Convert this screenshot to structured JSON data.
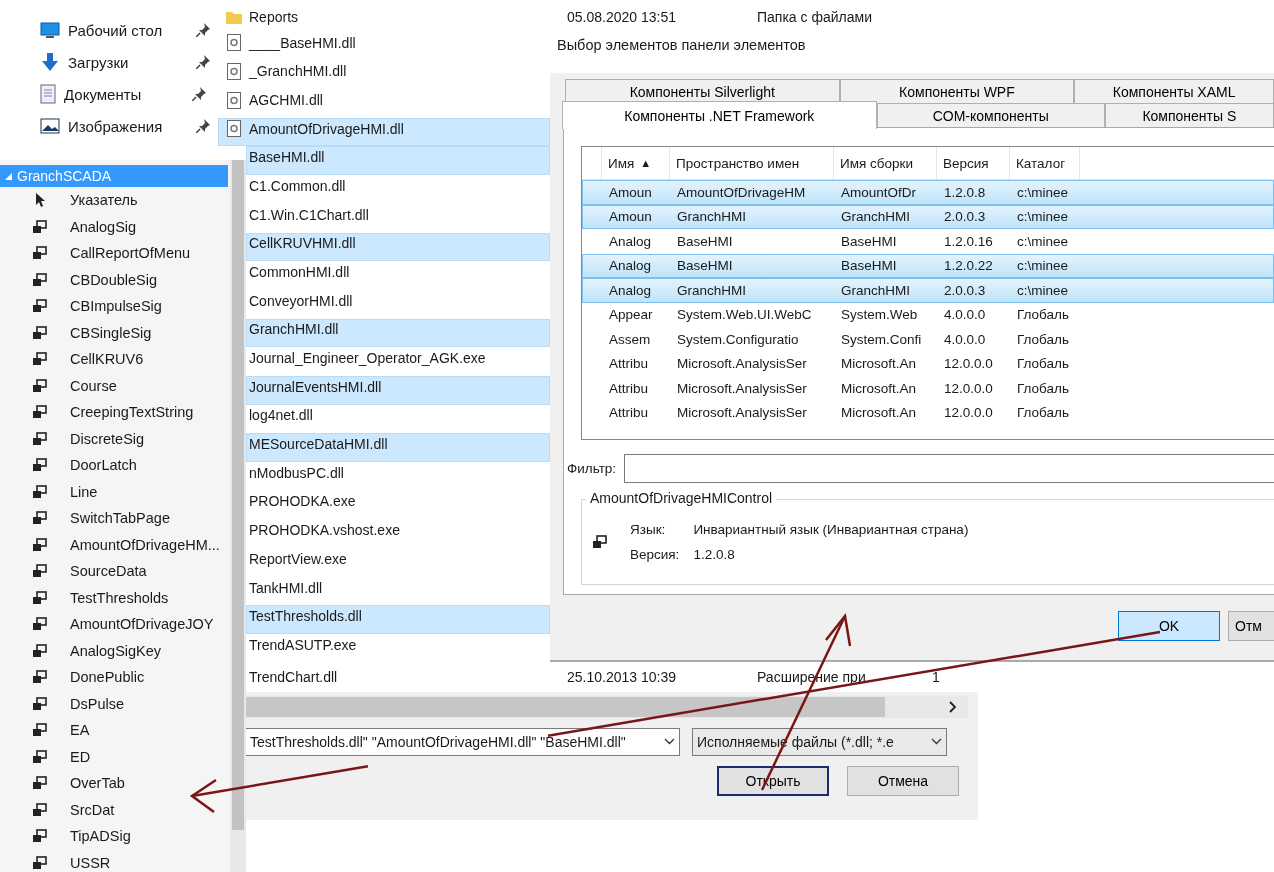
{
  "quick_access": [
    {
      "label": "Рабочий стол",
      "kind": "desktop"
    },
    {
      "label": "Загрузки",
      "kind": "downloads"
    },
    {
      "label": "Документы",
      "kind": "documents"
    },
    {
      "label": "Изображения",
      "kind": "pictures"
    }
  ],
  "toolbox": {
    "group": "GranchSCADA",
    "group_expanded": true,
    "items": [
      {
        "label": "Указатель",
        "kind": "pointer"
      },
      {
        "label": "AnalogSig",
        "kind": "control"
      },
      {
        "label": "CallReportOfMenu",
        "kind": "control"
      },
      {
        "label": "CBDoubleSig",
        "kind": "control"
      },
      {
        "label": "CBImpulseSig",
        "kind": "control"
      },
      {
        "label": "CBSingleSig",
        "kind": "control"
      },
      {
        "label": "CellKRUV6",
        "kind": "control"
      },
      {
        "label": "Course",
        "kind": "control"
      },
      {
        "label": "CreepingTextString",
        "kind": "control"
      },
      {
        "label": "DiscreteSig",
        "kind": "control"
      },
      {
        "label": "DoorLatch",
        "kind": "control"
      },
      {
        "label": "Line",
        "kind": "control"
      },
      {
        "label": "SwitchTabPage",
        "kind": "control"
      },
      {
        "label": "AmountOfDrivageHM...",
        "kind": "control"
      },
      {
        "label": "SourceData",
        "kind": "control"
      },
      {
        "label": "TestThresholds",
        "kind": "control"
      },
      {
        "label": "AmountOfDrivageJOY",
        "kind": "control"
      },
      {
        "label": "AnalogSigKey",
        "kind": "control"
      },
      {
        "label": "DonePublic",
        "kind": "control"
      },
      {
        "label": "DsPulse",
        "kind": "control"
      },
      {
        "label": "EA",
        "kind": "control"
      },
      {
        "label": "ED",
        "kind": "control"
      },
      {
        "label": "OverTab",
        "kind": "control"
      },
      {
        "label": "SrcDat",
        "kind": "control"
      },
      {
        "label": "TipADSig",
        "kind": "control"
      },
      {
        "label": "USSR",
        "kind": "control"
      }
    ]
  },
  "file_dialog": {
    "files": [
      {
        "name": "Reports",
        "kind": "folder",
        "selected": false,
        "date": "05.08.2020 13:51",
        "type": "Папка с файлами"
      },
      {
        "name": "____BaseHMI.dll",
        "kind": "dll",
        "selected": false
      },
      {
        "name": "_GranchHMI.dll",
        "kind": "dll",
        "selected": false
      },
      {
        "name": "AGCHMI.dll",
        "kind": "dll",
        "selected": false
      },
      {
        "name": "AmountOfDrivageHMI.dll",
        "kind": "dll",
        "selected": true
      },
      {
        "name": "BaseHMI.dll",
        "selected": true
      },
      {
        "name": "C1.Common.dll",
        "selected": false
      },
      {
        "name": "C1.Win.C1Chart.dll",
        "selected": false
      },
      {
        "name": "CellKRUVHMI.dll",
        "selected": true
      },
      {
        "name": "CommonHMI.dll",
        "selected": false
      },
      {
        "name": "ConveyorHMI.dll",
        "selected": false
      },
      {
        "name": "GranchHMI.dll",
        "selected": true
      },
      {
        "name": "Journal_Engineer_Operator_AGK.exe",
        "selected": false
      },
      {
        "name": "JournalEventsHMI.dll",
        "selected": true
      },
      {
        "name": "log4net.dll",
        "selected": false
      },
      {
        "name": "MESourceDataHMI.dll",
        "selected": true
      },
      {
        "name": "nModbusPC.dll",
        "selected": false
      },
      {
        "name": "PROHODKA.exe",
        "selected": false
      },
      {
        "name": "PROHODKA.vshost.exe",
        "selected": false
      },
      {
        "name": "ReportView.exe",
        "selected": false
      },
      {
        "name": "TankHMI.dll",
        "selected": false
      },
      {
        "name": "TestThresholds.dll",
        "selected": true
      },
      {
        "name": "TrendASUTP.exe",
        "selected": false
      },
      {
        "name": "TrendChart.dll",
        "selected": false,
        "date": "25.10.2013 10:39",
        "type": "Расширение при",
        "size": "1"
      }
    ],
    "file_name": "TestThresholds.dll\" \"AmountOfDrivageHMI.dll\" \"BaseHMI.dll\"",
    "file_type": "Исполняемые файлы (*.dll; *.e",
    "buttons": [
      {
        "label": "Открыть",
        "default": true
      },
      {
        "label": "Отмена",
        "default": false
      }
    ]
  },
  "choose_items_dialog": {
    "title": "Выбор элементов панели элементов",
    "tab_rows": [
      [
        {
          "label": "Компоненты Silverlight",
          "selected": false
        },
        {
          "label": "Компоненты WPF",
          "selected": false
        },
        {
          "label": "Компоненты XAML",
          "selected": false
        }
      ],
      [
        {
          "label": "Компоненты .NET Framework",
          "selected": true
        },
        {
          "label": "COM-компоненты",
          "selected": false
        },
        {
          "label": "Компоненты S",
          "selected": false
        }
      ]
    ],
    "table": {
      "columns": [
        {
          "label": "Имя",
          "sort_mark": "▲"
        },
        {
          "label": "Пространство имен"
        },
        {
          "label": "Имя сборки"
        },
        {
          "label": "Версия"
        },
        {
          "label": "Каталог"
        }
      ],
      "rows": [
        {
          "selected": true,
          "cells": [
            "Amoun",
            "AmountOfDrivageHM",
            "AmountOfDr",
            "1.2.0.8",
            "c:\\minee"
          ]
        },
        {
          "selected": true,
          "cells": [
            "Amoun",
            "GranchHMI",
            "GranchHMI",
            "2.0.0.3",
            "c:\\minee"
          ]
        },
        {
          "selected": false,
          "cells": [
            "Analog",
            "BaseHMI",
            "BaseHMI",
            "1.2.0.16",
            "c:\\minee"
          ]
        },
        {
          "selected": true,
          "cells": [
            "Analog",
            "BaseHMI",
            "BaseHMI",
            "1.2.0.22",
            "c:\\minee"
          ]
        },
        {
          "selected": true,
          "cells": [
            "Analog",
            "GranchHMI",
            "GranchHMI",
            "2.0.0.3",
            "c:\\minee"
          ]
        },
        {
          "selected": false,
          "cells": [
            "Appear",
            "System.Web.UI.WebC",
            "System.Web",
            "4.0.0.0",
            "Глобаль"
          ]
        },
        {
          "selected": false,
          "cells": [
            "Assem",
            "System.Configuratio",
            "System.Confi",
            "4.0.0.0",
            "Глобаль"
          ]
        },
        {
          "selected": false,
          "cells": [
            "Attribu",
            "Microsoft.AnalysisSer",
            "Microsoft.An",
            "12.0.0.0",
            "Глобаль"
          ]
        },
        {
          "selected": false,
          "cells": [
            "Attribu",
            "Microsoft.AnalysisSer",
            "Microsoft.An",
            "12.0.0.0",
            "Глобаль"
          ]
        },
        {
          "selected": false,
          "cells": [
            "Attribu",
            "Microsoft.AnalysisSer",
            "Microsoft.An",
            "12.0.0.0",
            "Глобаль"
          ]
        }
      ]
    },
    "filter": {
      "label": "Фильтр:"
    },
    "details": {
      "title": "AmountOfDrivageHMIControl",
      "language_label": "Язык:",
      "language": "Инвариантный язык (Инвариантная страна)",
      "version_label": "Версия:",
      "version": "1.2.0.8"
    },
    "buttons": [
      {
        "label": "OK",
        "default": true
      },
      {
        "label": "Отм",
        "default": false
      }
    ]
  }
}
